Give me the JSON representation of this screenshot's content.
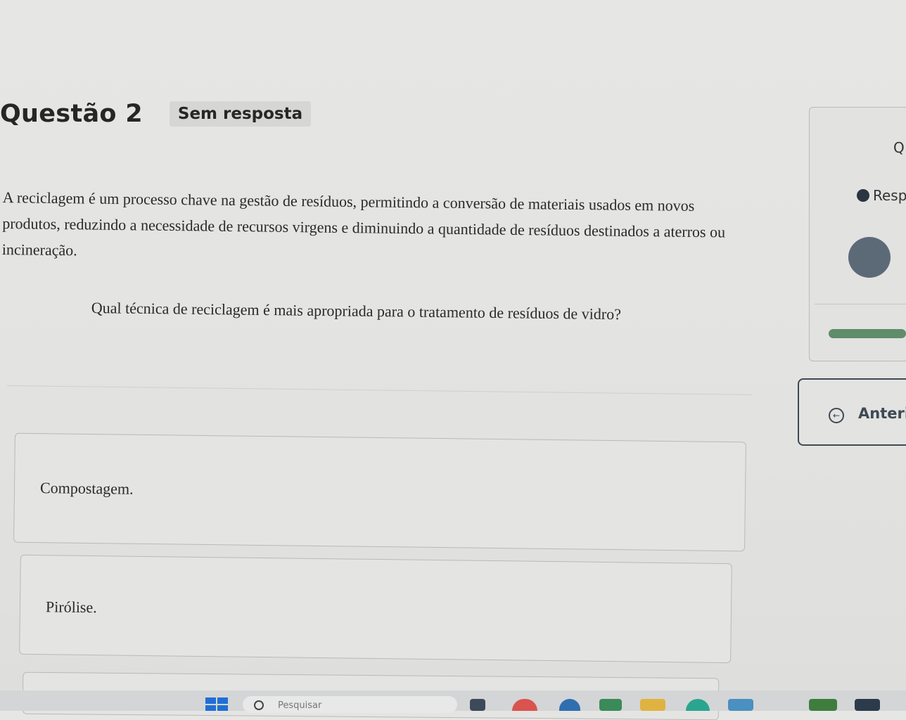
{
  "question": {
    "title": "Questão 2",
    "status_badge": "Sem resposta",
    "text": "A reciclagem é um processo chave na gestão de resíduos, permitindo a conversão de materiais usados em novos produtos, reduzindo a necessidade de recursos virgens e diminuindo a quantidade de resíduos destinados a aterros ou incineração.",
    "prompt": "Qual técnica de reciclagem é mais apropriada para o tratamento de resíduos de vidro?"
  },
  "options": [
    {
      "label": "Compostagem."
    },
    {
      "label": "Pirólise."
    }
  ],
  "side_panel": {
    "corner_label": "Q",
    "legend_label": "Resp",
    "previous_button": "Anteri"
  },
  "taskbar": {
    "search_placeholder": "Pesquisar",
    "icons": [
      "windows-start-icon",
      "search-icon",
      "app-icon",
      "chrome-icon",
      "app-icon",
      "app-icon",
      "folder-icon",
      "edge-icon",
      "app-icon",
      "app-icon"
    ]
  },
  "colors": {
    "accent": "#3e4a55",
    "progress": "#5f8c6a",
    "start_blue": "#1f6fd6"
  }
}
